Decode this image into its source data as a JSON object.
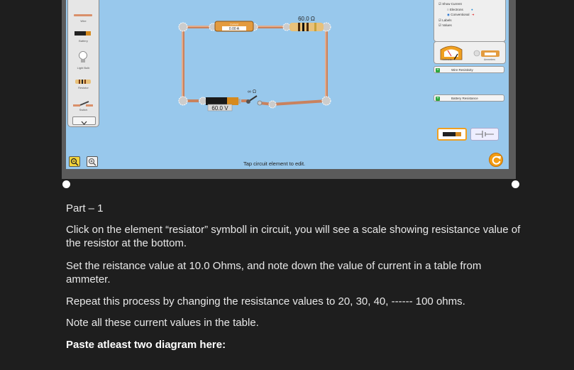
{
  "toolbox": {
    "items": [
      {
        "label": "Wire",
        "icon": "wire-icon"
      },
      {
        "label": "Battery",
        "icon": "battery-icon"
      },
      {
        "label": "Light Bulb",
        "icon": "light-bulb-icon"
      },
      {
        "label": "Resistor",
        "icon": "resistor-icon"
      },
      {
        "label": "Switch",
        "icon": "switch-icon"
      }
    ],
    "scroll_down": "chevron-down-icon"
  },
  "circuit": {
    "ammeter_title": "Current",
    "ammeter_value": "0.00 A",
    "resistor_value": "60.0 Ω",
    "battery_value": "60.0 V",
    "switch_value": "∞ Ω"
  },
  "right_panel": {
    "show_current": "Show Current",
    "electrons": "Electrons",
    "conventional": "Conventional",
    "labels": "Labels",
    "values": "Values",
    "voltmeter": "Voltmeter",
    "ammeters": "Ammeters",
    "wire_resistivity": "Wire Resistivity",
    "battery_resistance": "Battery Resistance"
  },
  "status": {
    "tap_hint": "Tap circuit element to edit."
  },
  "document": {
    "heading": "Part – 1",
    "p1": "Click on the element “resiator” symboll in circuit, you will see a scale showing resistance value of the  resistor at the bottom.",
    "p2": "Set the reistance value at 10.0 Ohms, and note down the  value of current in a table from ammeter.",
    "p3": "Repeat this process by changing the resistance values to 20, 30, 40, ------ 100 ohms.",
    "p4": "Note all these current values in the table.",
    "p5": "Paste atleast two diagram here:"
  },
  "colors": {
    "sim_bg": "#98c8ec",
    "wire": "#d9906a",
    "accent_orange": "#f39c12"
  }
}
